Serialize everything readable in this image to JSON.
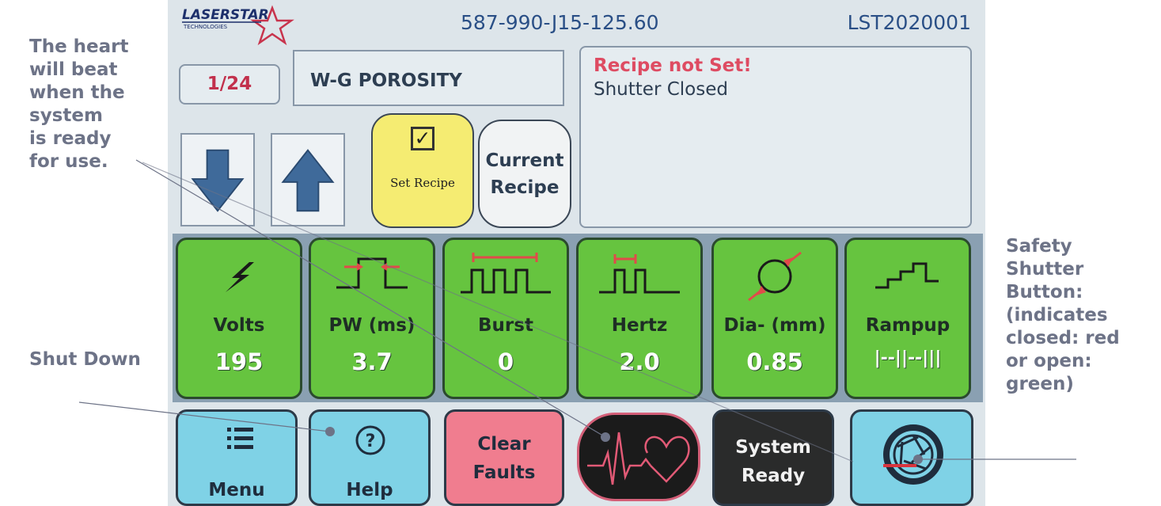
{
  "annotations": {
    "heart_note": [
      "The heart",
      "will beat",
      "when the",
      "system",
      "is ready",
      "for use."
    ],
    "shutdown_note": "Shut Down",
    "shutter_note": [
      "Safety",
      "Shutter",
      "Button:",
      "(indicates",
      "closed: red",
      "or open:",
      "green)"
    ]
  },
  "header": {
    "logo_text": "LASERSTAR",
    "logo_subtext": "TECHNOLOGIES",
    "part_number": "587-990-J15-125.60",
    "serial_number": "LST2020001"
  },
  "recipe": {
    "index": "1/24",
    "name": "W-G POROSITY"
  },
  "status": {
    "line1": "Recipe not Set!",
    "line2": "Shutter Closed"
  },
  "buttons": {
    "set_recipe": "Set Recipe",
    "current_recipe": [
      "Current",
      "Recipe"
    ],
    "menu": "Menu",
    "help": "Help",
    "clear_faults": [
      "Clear",
      "Faults"
    ],
    "system_ready": [
      "System",
      "Ready"
    ]
  },
  "parameters": [
    {
      "label": "Volts",
      "value": "195",
      "icon": "lightning-icon"
    },
    {
      "label": "PW (ms)",
      "value": "3.7",
      "icon": "pulse-width-icon"
    },
    {
      "label": "Burst",
      "value": "0",
      "icon": "burst-icon"
    },
    {
      "label": "Hertz",
      "value": "2.0",
      "icon": "hertz-icon"
    },
    {
      "label": "Dia- (mm)",
      "value": "0.85",
      "icon": "diameter-icon"
    },
    {
      "label": "Rampup",
      "value": "|--||--|||",
      "icon": "rampup-icon"
    }
  ],
  "colors": {
    "param_green": "#66c43f",
    "button_cyan": "#7fd2e6",
    "clear_faults_red": "#f07d8f",
    "status_alert_red": "#de4b62",
    "set_recipe_yellow": "#f5ec72"
  }
}
